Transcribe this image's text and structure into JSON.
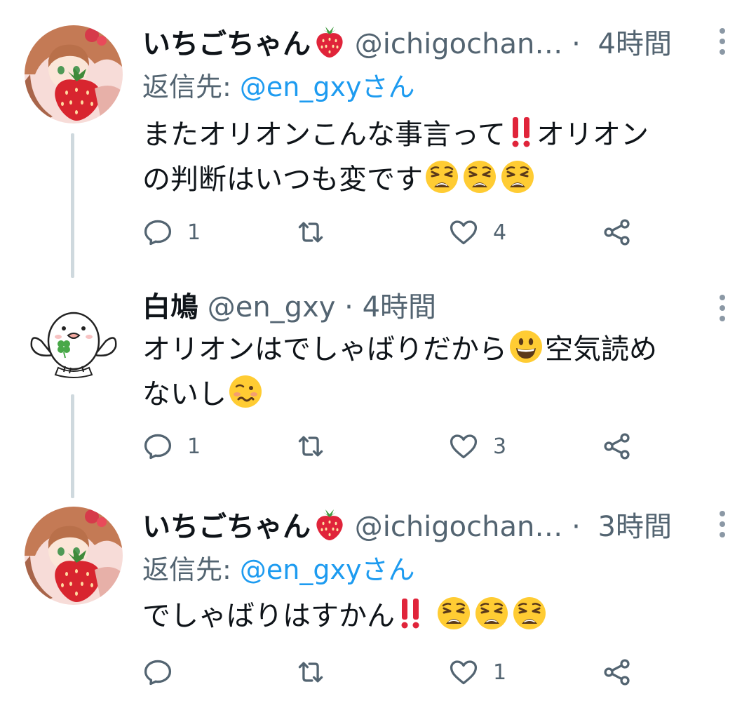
{
  "thread": [
    {
      "display_name": "いちごちゃん",
      "name_emoji": "strawberry",
      "handle": "@ichigochan…",
      "separator": "·",
      "time": "4時間",
      "reply_to_label": "返信先: ",
      "reply_to_handle": "@en_gxyさん",
      "text_line1": "またオリオンこんな事言って",
      "text_line1_after": "オリオン",
      "text_line2": "の判断はいつも変です",
      "emojis": [
        "double-exclamation",
        "weary-face",
        "weary-face",
        "weary-face"
      ],
      "replies": "1",
      "retweets": "",
      "likes": "4"
    },
    {
      "display_name": "白鳩",
      "handle": "@en_gxy",
      "separator": "·",
      "time": "4時間",
      "text_line1": "オリオンはでしゃばりだから",
      "text_line1_after": "空気読め",
      "text_line2": "ないし",
      "emojis": [
        "grinning-face",
        "woozy-face"
      ],
      "replies": "1",
      "retweets": "",
      "likes": "3"
    },
    {
      "display_name": "いちごちゃん",
      "name_emoji": "strawberry",
      "handle": "@ichigochan…",
      "separator": "·",
      "time": "3時間",
      "reply_to_label": "返信先: ",
      "reply_to_handle": "@en_gxyさん",
      "text_line1": "でしゃばりはすかん",
      "emojis": [
        "double-exclamation",
        "weary-face",
        "weary-face",
        "weary-face"
      ],
      "replies": "",
      "retweets": "",
      "likes": "1"
    }
  ],
  "icons": {
    "reply": "reply-icon",
    "retweet": "retweet-icon",
    "like": "heart-icon",
    "share": "share-icon",
    "more": "more-icon"
  },
  "colors": {
    "text": "#0f1419",
    "secondary": "#536471",
    "link": "#1d9bf0",
    "thread_line": "#cfd9de",
    "strawberry": "#e0243a",
    "emoji_yellow": "#ffcc33"
  }
}
